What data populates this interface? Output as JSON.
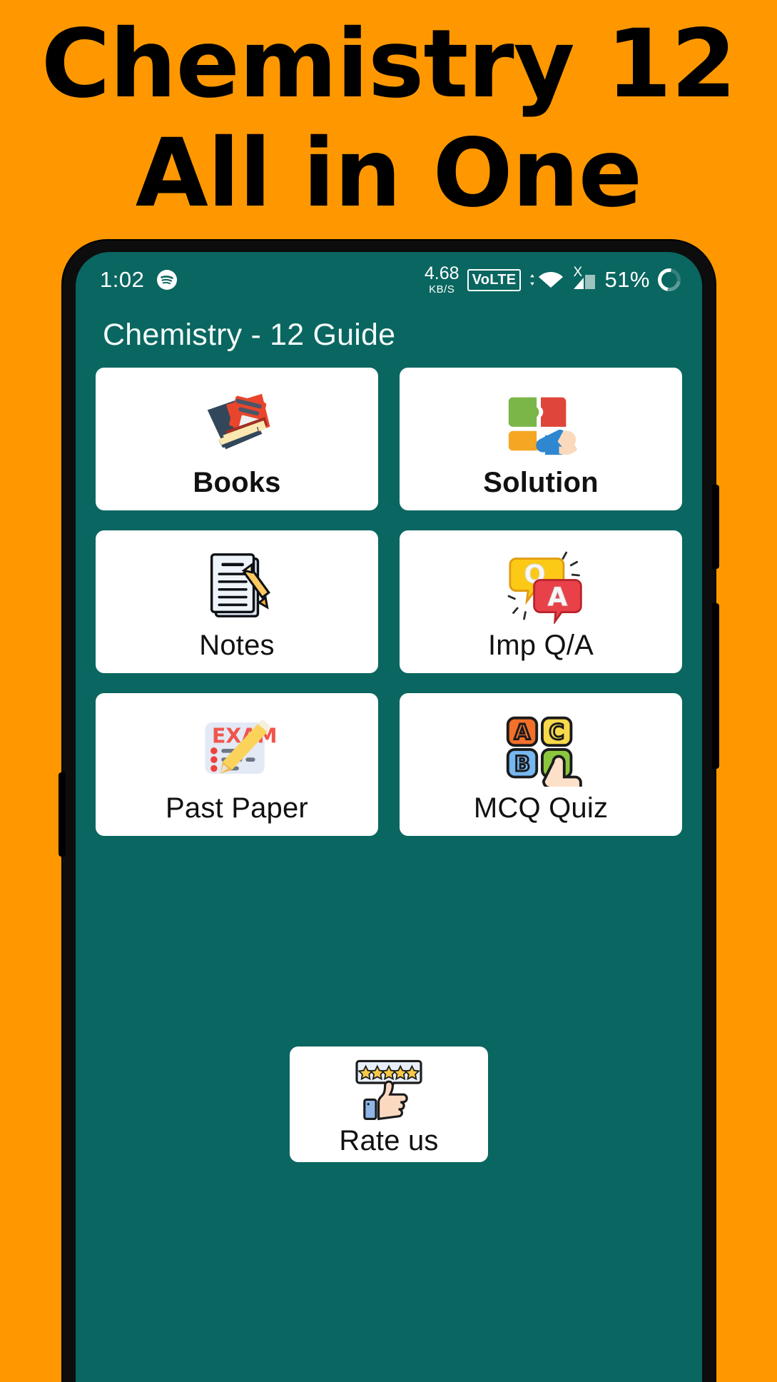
{
  "promo": {
    "headline_line1": "Chemistry 12",
    "headline_line2": "All in One",
    "background_color": "#FF9800",
    "text_color": "#000000"
  },
  "phone": {
    "screen_background": "#0A6660",
    "card_background": "#FFFFFF"
  },
  "statusbar": {
    "time": "1:02",
    "music_icon": "spotify-icon",
    "network_speed_value": "4.68",
    "network_speed_unit": "KB/S",
    "volte_label": "VoLTE",
    "wifi_icon": "wifi-icon",
    "signal_icon": "signal-bars-icon",
    "signal_badge": "X",
    "battery_percent": "51%",
    "battery_icon": "battery-ring-icon"
  },
  "appbar": {
    "title": "Chemistry - 12 Guide"
  },
  "grid": {
    "items": [
      {
        "label": "Books",
        "icon": "books-icon"
      },
      {
        "label": "Solution",
        "icon": "puzzle-hand-icon"
      },
      {
        "label": "Notes",
        "icon": "notes-pencil-icon"
      },
      {
        "label": "Imp Q/A",
        "icon": "qa-speech-bubbles-icon"
      },
      {
        "label": "Past Paper",
        "icon": "exam-paper-pencil-icon"
      },
      {
        "label": "MCQ Quiz",
        "icon": "mcq-abc-hand-icon"
      }
    ]
  },
  "rate": {
    "label": "Rate us",
    "icon": "thumbs-up-stars-icon",
    "stars": 5
  }
}
